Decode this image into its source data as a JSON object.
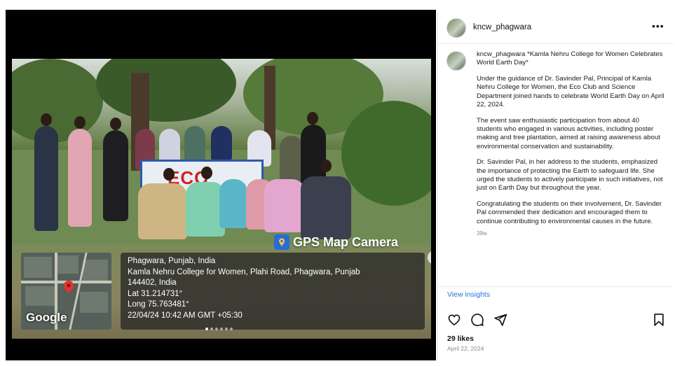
{
  "photo": {
    "banner_text": "ECO CLUB",
    "gps_watermark": "GPS Map Camera",
    "map_brand": "Google",
    "location_lines": [
      "Phagwara, Punjab, India",
      "Kamla Nehru College for Women, Plahi Road, Phagwara, Punjab",
      "144402, India",
      "Lat 31.214731°",
      "Long 75.763481°",
      "22/04/24 10:42 AM GMT +05:30"
    ],
    "carousel_dots": 6,
    "carousel_active_index": 0
  },
  "post": {
    "username": "kncw_phagwara",
    "caption_username": "kncw_phagwara",
    "caption_title": "*Kamla Nehru College for Women Celebrates World Earth Day*",
    "paragraphs": [
      "Under the guidance of Dr. Savinder Pal, Principal of Kamla Nehru College for Women, the Eco Club and Science Department joined hands to celebrate World Earth Day on April 22, 2024.",
      "The event saw enthusiastic participation from about 40 students who engaged in various activities, including poster making and tree plantation, aimed at raising awareness about environmental conservation and sustainability.",
      "Dr. Savinder Pal, in her address to the students, emphasized the importance of protecting the Earth to safeguard life. She urged the students to actively participate in such initiatives, not just on Earth Day but throughout the year.",
      "Congratulating the students on their involvement, Dr. Savinder Pal commended their dedication and encouraged them to continue contributing to environmental causes in the future."
    ],
    "time_ago": "39w",
    "view_insights": "View insights",
    "likes": "29 likes",
    "date": "April 22, 2024",
    "link_color": "#2b72d6"
  },
  "icons": {
    "more": "more-options-icon",
    "like": "heart-icon",
    "comment": "comment-icon",
    "share": "share-icon",
    "save": "bookmark-icon",
    "next": "chevron-right-icon"
  }
}
